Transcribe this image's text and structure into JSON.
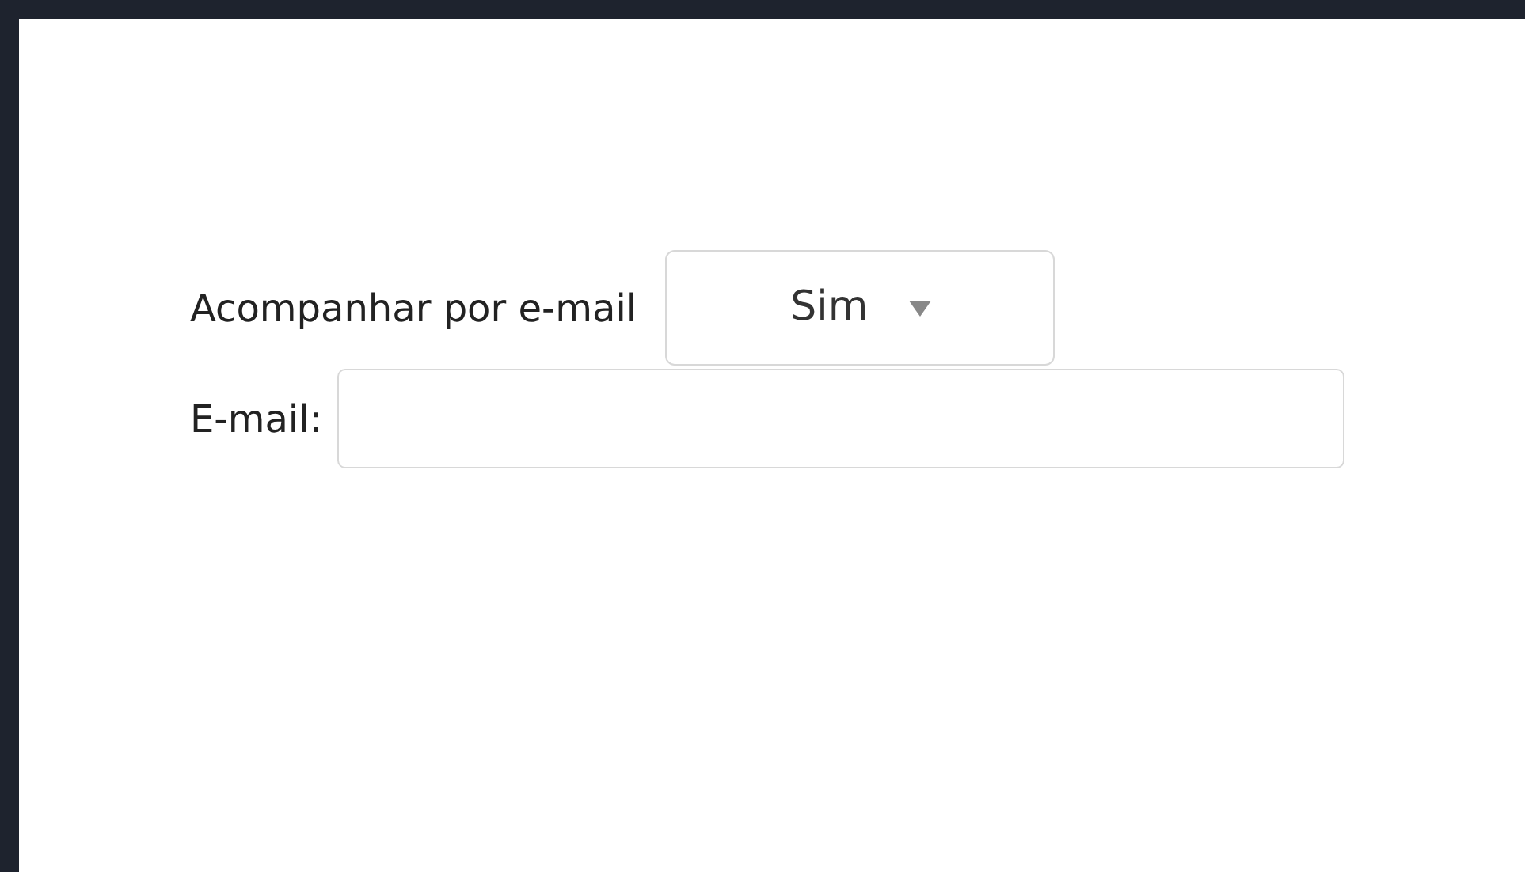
{
  "follow_by_email": {
    "label": "Acompanhar por e-mail",
    "value": "Sim"
  },
  "email": {
    "label": "E-mail:"
  }
}
